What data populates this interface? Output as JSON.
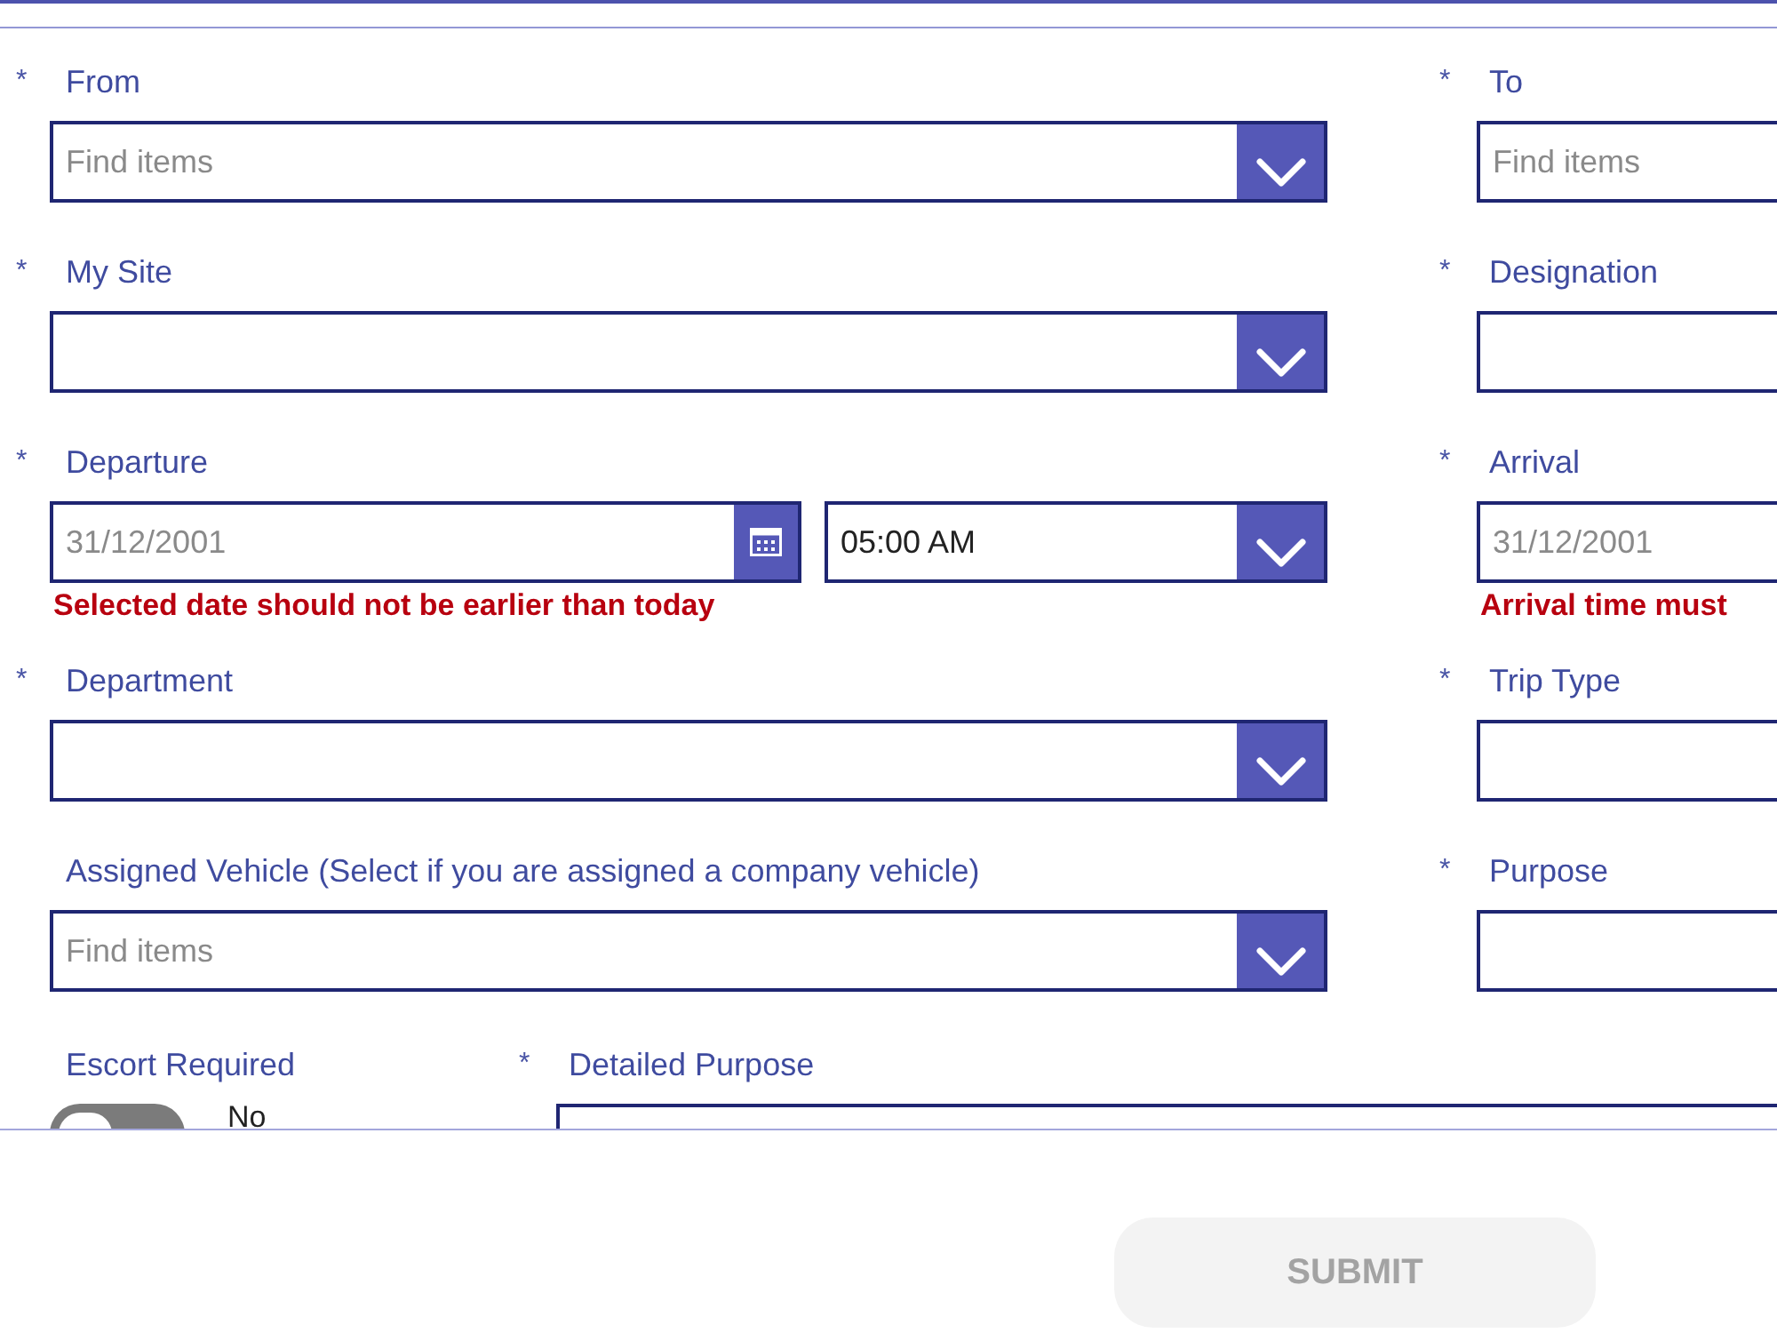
{
  "rows": [
    {
      "left": {
        "kind": "combobox",
        "required_mark": "*",
        "label": "From",
        "placeholder": "Find items"
      },
      "right": {
        "kind": "input",
        "required_mark": "*",
        "label": "To",
        "placeholder": "Find items"
      }
    },
    {
      "left": {
        "kind": "combobox",
        "required_mark": "*",
        "label": "My Site"
      },
      "right": {
        "kind": "input",
        "required_mark": "*",
        "label": "Designation"
      }
    },
    {
      "left": {
        "kind": "datetime",
        "required_mark": "*",
        "label": "Departure",
        "date_placeholder": "31/12/2001",
        "time_value": "05:00 AM",
        "error": "Selected date should not be earlier than today"
      },
      "right": {
        "kind": "input",
        "required_mark": "*",
        "label": "Arrival",
        "placeholder": "31/12/2001",
        "error": "Arrival time must"
      }
    },
    {
      "left": {
        "kind": "combobox",
        "required_mark": "*",
        "label": "Department"
      },
      "right": {
        "kind": "input",
        "required_mark": "*",
        "label": "Trip Type"
      }
    },
    {
      "left": {
        "kind": "combobox",
        "label": "Assigned Vehicle (Select if you are assigned a company vehicle)",
        "placeholder": "Find items"
      },
      "right": {
        "kind": "input",
        "required_mark": "*",
        "label": "Purpose"
      }
    }
  ],
  "escort": {
    "label": "Escort Required",
    "on": false,
    "state_label": "No"
  },
  "detailed_purpose": {
    "required_mark": "*",
    "label": "Detailed Purpose"
  },
  "submit": {
    "label": "SUBMIT",
    "disabled": true
  }
}
